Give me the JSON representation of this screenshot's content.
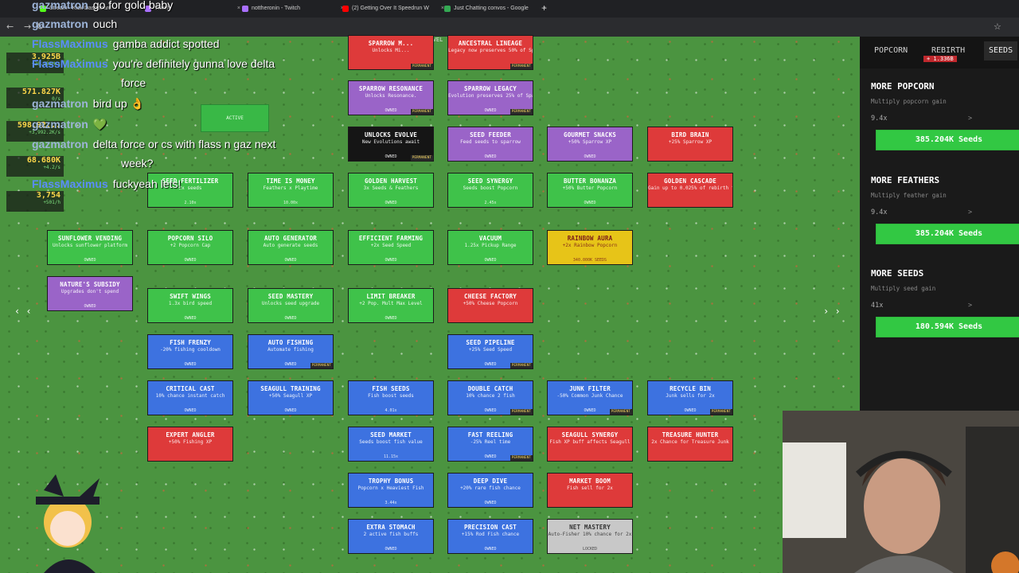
{
  "browser": {
    "tabs": [
      {
        "label": "Stream - Kick Dashboard",
        "color": "#53fc18"
      },
      {
        "label": "Twitch",
        "color": "#a970ff"
      },
      {
        "label": "nottheronin - Twitch",
        "color": "#a970ff"
      },
      {
        "label": "(2) Getting Over It Speedrun W",
        "color": "#ff0000"
      },
      {
        "label": "Just Chatting convos - Google",
        "color": "#34a853"
      }
    ],
    "new_tab": "+"
  },
  "chat": [
    {
      "user": "gazmatron",
      "text": "go for gold baby",
      "user_color": "gaz"
    },
    {
      "user": "gazmatron",
      "text": "ouch",
      "user_color": "gaz"
    },
    {
      "user": "FlassMaximus",
      "text": "gamba addict spotted",
      "user_color": "flass"
    },
    {
      "user": "FlassMaximus",
      "text": "you're definitely gunna love delta",
      "user_color": "flass"
    },
    {
      "user": "",
      "text": "force",
      "user_color": "flass"
    },
    {
      "user": "gazmatron",
      "text": "bird up 👌",
      "user_color": "gaz"
    },
    {
      "user": "gazmatron",
      "text": "💚",
      "user_color": "gaz"
    },
    {
      "user": "gazmatron",
      "text": "delta force or cs with flass n gaz next",
      "user_color": "gaz"
    },
    {
      "user": "",
      "text": "week?",
      "user_color": "gaz"
    },
    {
      "user": "FlassMaximus",
      "text": "fuckyeah lets!",
      "user_color": "flass"
    }
  ],
  "stats": [
    {
      "value": "3.925B",
      "rate": "+36.235M/s"
    },
    {
      "value": "571.827K",
      "rate": "0/s"
    },
    {
      "value": "598.92...",
      "rate": "+3,992.2K/s"
    },
    {
      "value": "68.680K",
      "rate": "+4.2/s"
    },
    {
      "value": "3,754",
      "rate": "+501/h"
    }
  ],
  "game": {
    "fast_travel": "FAST TRAVEL",
    "active_label": "ACTIVE",
    "nodes": [
      {
        "id": "sparrow-m",
        "title": "SPARROW M...",
        "desc": "Unlocks Mi...",
        "status": "",
        "badge": "PERMANENT",
        "color": "red"
      },
      {
        "id": "ancestral-lineage",
        "title": "ANCESTRAL LINEAGE",
        "desc": "Legacy now preserves 50% of Sparrow XP",
        "status": "",
        "badge": "PERMANENT",
        "color": "red"
      },
      {
        "id": "sparrow-resonance",
        "title": "SPARROW RESONANCE",
        "desc": "Unlocks Resonance.",
        "status": "OWNED",
        "badge": "PERMANENT",
        "color": "purple"
      },
      {
        "id": "sparrow-legacy",
        "title": "SPARROW LEGACY",
        "desc": "Evolution preserves 25% of Sparrow XP",
        "status": "OWNED",
        "badge": "PERMANENT",
        "color": "purple"
      },
      {
        "id": "unlocks-evolve",
        "title": "UNLOCKS EVOLVE",
        "desc": "New Evolutions await",
        "status": "OWNED",
        "badge": "PERMANENT",
        "color": "black"
      },
      {
        "id": "seed-feeder",
        "title": "SEED FEEDER",
        "desc": "Feed seeds to sparrow",
        "status": "OWNED",
        "badge": "",
        "color": "purple"
      },
      {
        "id": "gourmet-snacks",
        "title": "GOURMET SNACKS",
        "desc": "+50% Sparrow XP",
        "status": "OWNED",
        "badge": "",
        "color": "purple"
      },
      {
        "id": "bird-brain",
        "title": "BIRD BRAIN",
        "desc": "+25% Sparrow XP",
        "status": "",
        "badge": "",
        "color": "red"
      },
      {
        "id": "seed-fertilizer",
        "title": "SEED FERTILIZER",
        "desc": "2x seeds",
        "status": "2.10x",
        "badge": "",
        "color": "green"
      },
      {
        "id": "time-is-money",
        "title": "TIME IS MONEY",
        "desc": "Feathers x Playtime",
        "status": "10.00x",
        "badge": "",
        "color": "green"
      },
      {
        "id": "golden-harvest",
        "title": "GOLDEN HARVEST",
        "desc": "3x Seeds & Feathers",
        "status": "OWNED",
        "badge": "",
        "color": "green"
      },
      {
        "id": "seed-synergy",
        "title": "SEED SYNERGY",
        "desc": "Seeds boost Popcorn",
        "status": "2.45x",
        "badge": "",
        "color": "green"
      },
      {
        "id": "butter-bonanza",
        "title": "BUTTER BONANZA",
        "desc": "+50% Butter Popcorn",
        "status": "OWNED",
        "badge": "",
        "color": "green"
      },
      {
        "id": "golden-cascade",
        "title": "GOLDEN CASCADE",
        "desc": "Gain up to 0.025% of rebirth feathers prod (diminishing)",
        "status": "",
        "badge": "",
        "color": "red"
      },
      {
        "id": "sunflower-vending",
        "title": "SUNFLOWER VENDING",
        "desc": "Unlocks sunflower platform",
        "status": "OWNED",
        "badge": "",
        "color": "green"
      },
      {
        "id": "popcorn-silo",
        "title": "POPCORN SILO",
        "desc": "+2 Popcorn Cap",
        "status": "OWNED",
        "badge": "",
        "color": "green"
      },
      {
        "id": "auto-generator",
        "title": "AUTO GENERATOR",
        "desc": "Auto generate seeds",
        "status": "OWNED",
        "badge": "",
        "color": "green"
      },
      {
        "id": "efficient-farming",
        "title": "EFFICIENT FARMING",
        "desc": "+2x Seed Speed",
        "status": "OWNED",
        "badge": "",
        "color": "green"
      },
      {
        "id": "vacuum",
        "title": "VACUUM",
        "desc": "1.25x Pickup Range",
        "status": "OWNED",
        "badge": "",
        "color": "green"
      },
      {
        "id": "rainbow-aura",
        "title": "RAINBOW AURA",
        "desc": "+2x Rainbow Popcorn",
        "status": "340.000K SEEDS",
        "badge": "",
        "color": "yellow"
      },
      {
        "id": "natures-subsidy",
        "title": "NATURE'S SUBSIDY",
        "desc": "Upgrades don't spend",
        "status": "OWNED",
        "badge": "",
        "color": "purple"
      },
      {
        "id": "swift-wings",
        "title": "SWIFT WINGS",
        "desc": "1.3x bird speed",
        "status": "OWNED",
        "badge": "",
        "color": "green"
      },
      {
        "id": "seed-mastery",
        "title": "SEED MASTERY",
        "desc": "Unlocks seed upgrade",
        "status": "OWNED",
        "badge": "",
        "color": "green"
      },
      {
        "id": "limit-breaker",
        "title": "LIMIT BREAKER",
        "desc": "+2 Pop. Mult Max Level",
        "status": "OWNED",
        "badge": "",
        "color": "green"
      },
      {
        "id": "cheese-factory",
        "title": "CHEESE FACTORY",
        "desc": "+50% Cheese Popcorn",
        "status": "",
        "badge": "",
        "color": "red"
      },
      {
        "id": "fish-frenzy",
        "title": "FISH FRENZY",
        "desc": "-20% fishing cooldown",
        "status": "OWNED",
        "badge": "",
        "color": "blue"
      },
      {
        "id": "auto-fishing",
        "title": "AUTO FISHING",
        "desc": "Automate fishing",
        "status": "OWNED",
        "badge": "PERMANENT",
        "color": "blue"
      },
      {
        "id": "seed-pipeline",
        "title": "SEED PIPELINE",
        "desc": "+25% Seed Speed",
        "status": "OWNED",
        "badge": "PERMANENT",
        "color": "blue"
      },
      {
        "id": "critical-cast",
        "title": "CRITICAL CAST",
        "desc": "10% chance instant catch",
        "status": "OWNED",
        "badge": "",
        "color": "blue"
      },
      {
        "id": "seagull-training",
        "title": "SEAGULL TRAINING",
        "desc": "+50% Seagull XP",
        "status": "OWNED",
        "badge": "",
        "color": "blue"
      },
      {
        "id": "fish-seeds",
        "title": "FISH SEEDS",
        "desc": "Fish boost seeds",
        "status": "4.01x",
        "badge": "",
        "color": "blue"
      },
      {
        "id": "double-catch",
        "title": "DOUBLE CATCH",
        "desc": "10% chance 2 fish",
        "status": "OWNED",
        "badge": "PERMANENT",
        "color": "blue"
      },
      {
        "id": "junk-filter",
        "title": "JUNK FILTER",
        "desc": "-50% Common Junk Chance",
        "status": "OWNED",
        "badge": "PERMANENT",
        "color": "blue"
      },
      {
        "id": "recycle-bin",
        "title": "RECYCLE BIN",
        "desc": "Junk sells for 2x",
        "status": "OWNED",
        "badge": "PERMANENT",
        "color": "blue"
      },
      {
        "id": "expert-angler",
        "title": "EXPERT ANGLER",
        "desc": "+50% Fishing XP",
        "status": "",
        "badge": "",
        "color": "red"
      },
      {
        "id": "seed-market",
        "title": "SEED MARKET",
        "desc": "Seeds boost fish value",
        "status": "11.15x",
        "badge": "",
        "color": "blue"
      },
      {
        "id": "fast-reeling",
        "title": "FAST REELING",
        "desc": "-25% Reel time",
        "status": "OWNED",
        "badge": "PERMANENT",
        "color": "blue"
      },
      {
        "id": "seagull-synergy",
        "title": "SEAGULL SYNERGY",
        "desc": "Fish XP buff affects Seagull",
        "status": "",
        "badge": "",
        "color": "red"
      },
      {
        "id": "treasure-hunter",
        "title": "TREASURE HUNTER",
        "desc": "2x Chance for Treasure Junk",
        "status": "",
        "badge": "",
        "color": "red"
      },
      {
        "id": "trophy-bonus",
        "title": "TROPHY BONUS",
        "desc": "Popcorn x Heaviest Fish",
        "status": "3.44x",
        "badge": "",
        "color": "blue"
      },
      {
        "id": "deep-dive",
        "title": "DEEP DIVE",
        "desc": "+20% rare fish chance",
        "status": "OWNED",
        "badge": "",
        "color": "blue"
      },
      {
        "id": "market-boom",
        "title": "MARKET BOOM",
        "desc": "Fish sell for 2x",
        "status": "",
        "badge": "",
        "color": "red"
      },
      {
        "id": "extra-stomach",
        "title": "EXTRA STOMACH",
        "desc": "2 active fish buffs",
        "status": "OWNED",
        "badge": "",
        "color": "blue"
      },
      {
        "id": "precision-cast",
        "title": "PRECISION CAST",
        "desc": "+15% Rod Fish chance",
        "status": "OWNED",
        "badge": "",
        "color": "blue"
      },
      {
        "id": "net-mastery",
        "title": "NET MASTERY",
        "desc": "Auto-Fisher 10% chance for 2x",
        "status": "LOCKED",
        "badge": "",
        "color": "grey"
      }
    ]
  },
  "panel": {
    "tabs": [
      {
        "label": "POPCORN",
        "active": false
      },
      {
        "label": "REBIRTH",
        "active": false
      },
      {
        "label": "SEEDS",
        "active": true
      }
    ],
    "rebirth_sub": "+ 1.336B",
    "cards": [
      {
        "title": "MORE POPCORN",
        "subtitle": "Multiply popcorn gain",
        "mult": "9.4x",
        "chevron": ">",
        "buy": "385.204K Seeds"
      },
      {
        "title": "MORE FEATHERS",
        "subtitle": "Multiply feather gain",
        "mult": "9.4x",
        "chevron": ">",
        "buy": "385.204K Seeds"
      },
      {
        "title": "MORE SEEDS",
        "subtitle": "Multiply seed gain",
        "mult": "41x",
        "chevron": ">",
        "buy": "180.594K Seeds"
      }
    ]
  },
  "theme": {
    "accent": "#32c843",
    "panel_bg": "#1a1a1a",
    "grass": "#4b9440"
  }
}
